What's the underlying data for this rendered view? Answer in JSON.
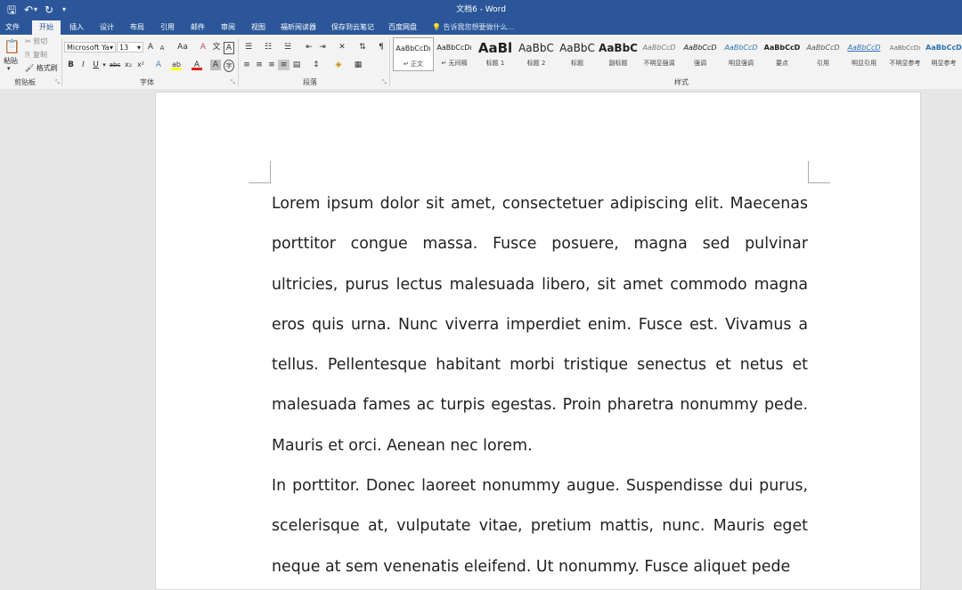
{
  "window": {
    "title": "文档6 - Word"
  },
  "quick_access": {
    "save": "🖫",
    "undo": "↶",
    "undo_dropdown": "▾",
    "redo": "↻",
    "customize": "▾"
  },
  "menu_tabs": [
    "文件",
    "开始",
    "插入",
    "设计",
    "布局",
    "引用",
    "邮件",
    "审阅",
    "视图",
    "福昕阅读器",
    "保存到云笔记",
    "百度网盘"
  ],
  "active_tab": "开始",
  "tell_me": "告诉我您想要做什么...",
  "clipboard": {
    "paste": "粘贴",
    "cut": "剪切",
    "copy": "复制",
    "format_painter": "格式刷",
    "label": "剪贴板"
  },
  "font": {
    "name": "Microsoft Ya",
    "size": "13",
    "grow": "A",
    "shrink": "A",
    "case": "Aa",
    "clear": "A",
    "phonetic": "文",
    "border_char": "A",
    "bold": "B",
    "italic": "I",
    "underline": "U",
    "strike": "abc",
    "subscript": "x₂",
    "superscript": "x²",
    "effects": "A",
    "highlight": "ab",
    "font_color": "A",
    "shade": "A",
    "enclose": "字",
    "label": "字体"
  },
  "paragraph": {
    "label": "段落"
  },
  "styles": {
    "label": "样式",
    "items": [
      {
        "sample": "AaBbCcDı",
        "name": "↵ 正文"
      },
      {
        "sample": "AaBbCcDı",
        "name": "↵ 无间隔"
      },
      {
        "sample": "AaBl",
        "name": "标题 1"
      },
      {
        "sample": "AaBbC",
        "name": "标题 2"
      },
      {
        "sample": "AaBbC",
        "name": "标题"
      },
      {
        "sample": "AaBbC",
        "name": "副标题"
      },
      {
        "sample": "AaBbCcD",
        "name": "不明显强调"
      },
      {
        "sample": "AaBbCcD",
        "name": "强调"
      },
      {
        "sample": "AaBbCcD",
        "name": "明显强调"
      },
      {
        "sample": "AaBbCcD",
        "name": "要点"
      },
      {
        "sample": "AaBbCcD",
        "name": "引用"
      },
      {
        "sample": "AaBbCcD",
        "name": "明显引用"
      },
      {
        "sample": "AaBbCcDı",
        "name": "不明显参考"
      },
      {
        "sample": "AaBbCcD",
        "name": "明显参考"
      }
    ]
  },
  "document": {
    "paragraphs": [
      "Lorem ipsum dolor sit amet, consectetuer adipiscing elit. Maecenas porttitor congue massa. Fusce posuere, magna sed pulvinar ultricies, purus lectus malesuada libero, sit amet commodo magna eros quis urna. Nunc viverra imperdiet enim. Fusce est. Vivamus a tellus. Pellentesque habitant morbi tristique senectus et netus et malesuada fames ac turpis egestas. Proin pharetra nonummy pede. Mauris et orci. Aenean nec lorem.",
      "In porttitor. Donec laoreet nonummy augue. Suspendisse dui purus, scelerisque at, vulputate vitae, pretium mattis, nunc. Mauris eget neque at sem venenatis eleifend. Ut nonummy. Fusce aliquet pede"
    ]
  },
  "colors": {
    "accent": "#2b579a",
    "ribbon_bg": "#f3f3f3",
    "workspace": "#e6e6e6",
    "heading_blue": "#2e74b5"
  }
}
